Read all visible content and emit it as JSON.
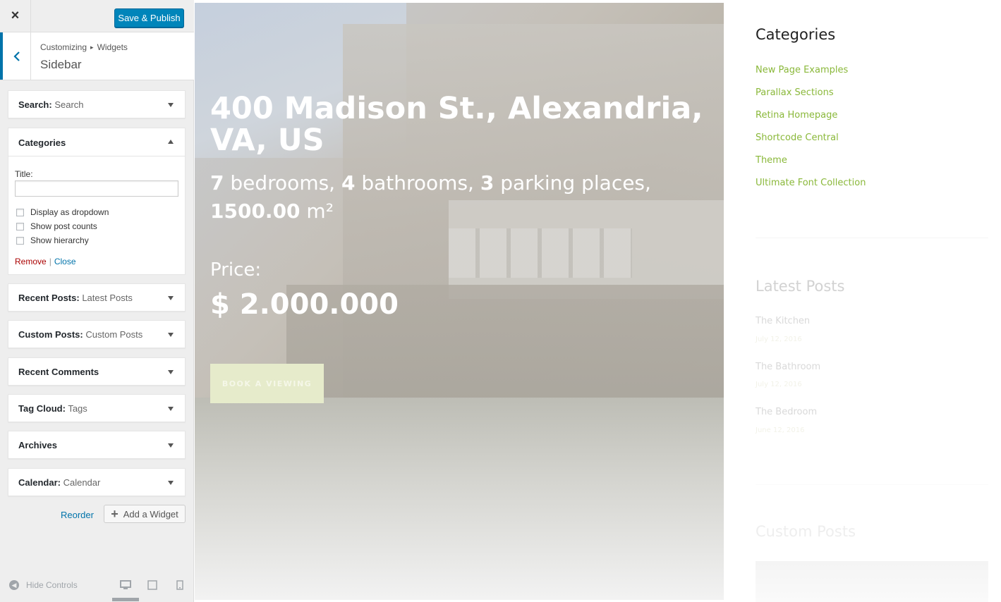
{
  "topbar": {
    "close_icon": "×",
    "publish_label": "Save & Publish"
  },
  "section": {
    "breadcrumb_root": "Customizing",
    "breadcrumb_sep": "▸",
    "breadcrumb_leaf": "Widgets",
    "title": "Sidebar"
  },
  "widgets": {
    "search": {
      "name": "Search:",
      "sub": "Search"
    },
    "categories": {
      "name": "Categories",
      "title_label": "Title:",
      "title_value": "",
      "options": [
        "Display as dropdown",
        "Show post counts",
        "Show hierarchy"
      ],
      "remove_label": "Remove",
      "divider": "|",
      "close_label": "Close"
    },
    "recent_posts": {
      "name": "Recent Posts:",
      "sub": "Latest Posts"
    },
    "custom_posts": {
      "name": "Custom Posts:",
      "sub": "Custom Posts"
    },
    "recent_comments": {
      "name": "Recent Comments",
      "sub": ""
    },
    "tag_cloud": {
      "name": "Tag Cloud:",
      "sub": "Tags"
    },
    "archives": {
      "name": "Archives",
      "sub": ""
    },
    "calendar": {
      "name": "Calendar:",
      "sub": "Calendar"
    }
  },
  "actions": {
    "reorder_label": "Reorder",
    "add_widget_label": "Add a Widget",
    "plus": "+"
  },
  "footer": {
    "hide_controls_label": "Hide Controls"
  },
  "hero": {
    "address": "400 Madison St., Alexandria, VA, US",
    "bedrooms_num": "7",
    "bedrooms_txt": " bedrooms, ",
    "bathrooms_num": "4",
    "bathrooms_txt": " bathrooms, ",
    "parking_num": "3",
    "parking_txt": " parking places,",
    "area_num": "1500.00",
    "area_unit": " m²",
    "price_label": "Price:",
    "price_value": "$ 2.000.000",
    "cta_label": "BOOK A VIEWING"
  },
  "sidebar_preview": {
    "categories_title": "Categories",
    "categories": [
      "New Page Examples",
      "Parallax Sections",
      "Retina Homepage",
      "Shortcode Central",
      "Theme",
      "Ultimate Font Collection"
    ],
    "latest_posts_title": "Latest Posts",
    "latest_posts": [
      {
        "title": "The Kitchen",
        "date": "July 12, 2016"
      },
      {
        "title": "The Bathroom",
        "date": "July 12, 2016"
      },
      {
        "title": "The Bedroom",
        "date": "June 12, 2016"
      }
    ],
    "custom_posts_title": "Custom Posts"
  },
  "colors": {
    "accent_blue": "#0085ba",
    "link_green": "#8ab83a",
    "remove_red": "#aa0000"
  }
}
